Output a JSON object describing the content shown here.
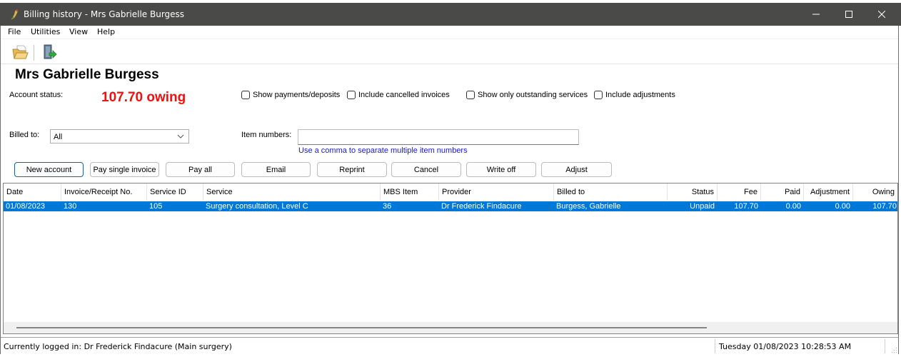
{
  "window": {
    "title": "Billing history - Mrs Gabrielle Burgess",
    "controls": [
      "minimize",
      "maximize",
      "close"
    ]
  },
  "menu": [
    "File",
    "Utilities",
    "View",
    "Help"
  ],
  "toolbar": {
    "items": [
      {
        "icon": "open-folder-icon"
      },
      {
        "icon": "exit-door-icon"
      }
    ]
  },
  "patient": {
    "name": "Mrs Gabrielle Burgess",
    "account_status_label": "Account status:",
    "account_status_value": "107.70 owing",
    "status_color": "#ee1111"
  },
  "filters": {
    "checkboxes": [
      {
        "label": "Show payments/deposits",
        "checked": false
      },
      {
        "label": "Include cancelled invoices",
        "checked": false
      },
      {
        "label": "Show only outstanding services",
        "checked": false
      },
      {
        "label": "Include adjustments",
        "checked": false
      }
    ],
    "billed_to_label": "Billed to:",
    "billed_to_value": "All",
    "item_numbers_label": "Item numbers:",
    "item_numbers_value": "",
    "item_numbers_hint": "Use a comma to separate multiple item numbers"
  },
  "actions": [
    "New account",
    "Pay single invoice",
    "Pay all",
    "Email",
    "Reprint",
    "Cancel",
    "Write off",
    "Adjust"
  ],
  "table": {
    "columns": [
      "Date",
      "Invoice/Receipt No.",
      "Service ID",
      "Service",
      "MBS Item",
      "Provider",
      "Billed to",
      "Status",
      "Fee",
      "Paid",
      "Adjustment",
      "Owing"
    ],
    "rows": [
      {
        "selected": true,
        "cells": [
          "01/08/2023",
          "130",
          "105",
          "Surgery consultation, Level C",
          "36",
          "Dr Frederick Findacure",
          "Burgess, Gabrielle",
          "Unpaid",
          "107.70",
          "0.00",
          "0.00",
          "107.70"
        ]
      }
    ],
    "selection_color": "#0078d7"
  },
  "statusbar": {
    "logged_in": "Currently logged in:  Dr Frederick Findacure (Main surgery)",
    "datetime": "Tuesday 01/08/2023 10:28:53 AM"
  }
}
